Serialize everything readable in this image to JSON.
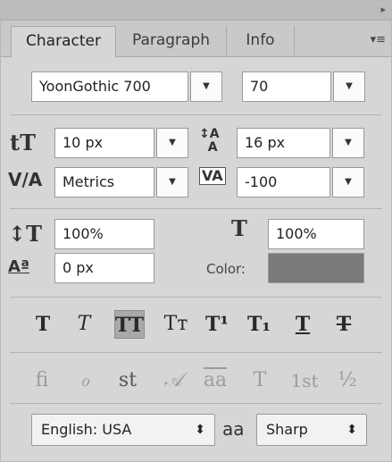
{
  "window": {
    "collapse_icon": "collapse-arrows-icon"
  },
  "tabs": [
    {
      "label": "Character",
      "active": true
    },
    {
      "label": "Paragraph",
      "active": false
    },
    {
      "label": "Info",
      "active": false
    }
  ],
  "menu_icon": "panel-menu-icon",
  "font": {
    "family": "YoonGothic 700",
    "size": "70"
  },
  "metrics": {
    "font_size": "10 px",
    "leading": "16 px",
    "kerning": "Metrics",
    "tracking": "-100",
    "vertical_scale": "100%",
    "horizontal_scale": "100%",
    "baseline_shift": "0 px",
    "color_label": "Color:",
    "color": "#7a7a7a"
  },
  "type_styles": [
    {
      "label": "T",
      "name": "faux-bold"
    },
    {
      "label": "T",
      "name": "faux-italic"
    },
    {
      "label": "TT",
      "name": "all-caps",
      "pressed": true
    },
    {
      "label": "Tт",
      "name": "small-caps"
    },
    {
      "label": "T¹",
      "name": "superscript"
    },
    {
      "label": "T₁",
      "name": "subscript"
    },
    {
      "label": "T",
      "name": "underline"
    },
    {
      "label": "T",
      "name": "strikethrough"
    }
  ],
  "opentype": [
    {
      "label": "fi",
      "name": "standard-ligatures"
    },
    {
      "label": "ℴ",
      "name": "contextual-alternates"
    },
    {
      "label": "st",
      "name": "discretionary-ligatures"
    },
    {
      "label": "𝒜",
      "name": "swash"
    },
    {
      "label": "aa",
      "name": "stylistic-alternates"
    },
    {
      "label": "T",
      "name": "titling-alternates"
    },
    {
      "label": "1st",
      "name": "ordinals"
    },
    {
      "label": "½",
      "name": "fractions"
    }
  ],
  "language": "English: USA",
  "aa_label": "aa",
  "antialias": "Sharp",
  "arrows": "⬍"
}
